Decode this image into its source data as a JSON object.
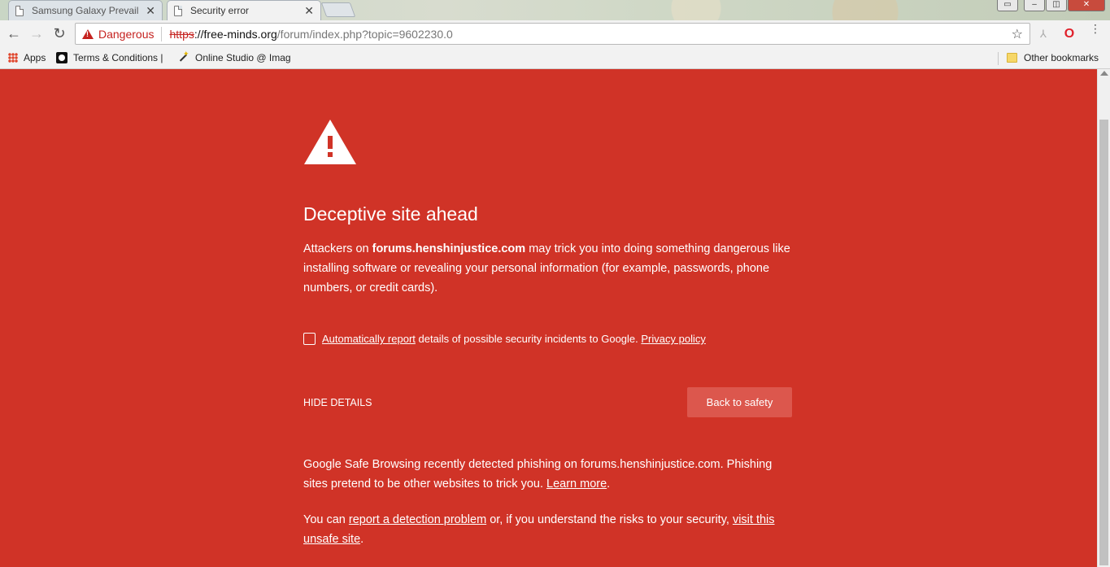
{
  "browser": {
    "tabs": [
      {
        "title": "Samsung Galaxy Prevail T",
        "close": "✕"
      },
      {
        "title": "Security error",
        "close": "✕"
      }
    ],
    "window_controls": [
      "▭",
      "–",
      "◫",
      "✕"
    ],
    "nav": {
      "back": "←",
      "forward": "→",
      "reload": "↻"
    },
    "omnibox": {
      "security_label": "Dangerous",
      "scheme": "https",
      "host": "://free-minds.org",
      "path": "/forum/index.php?topic=9602230.0",
      "star": "☆"
    },
    "extensions": {
      "pdf": "⅄",
      "opera": "O",
      "menu": "⋮"
    },
    "bookmarks": {
      "apps": "Apps",
      "terms": "Terms & Conditions |",
      "studio": "Online Studio @ Imag",
      "other": "Other bookmarks"
    }
  },
  "interstitial": {
    "icon": "warning-triangle-icon",
    "heading": "Deceptive site ahead",
    "intro_before": "Attackers on ",
    "site": "forums.henshinjustice.com",
    "intro_after": " may trick you into doing something dangerous like installing software or revealing your personal information (for example, passwords, phone numbers, or credit cards).",
    "optin_link": "Automatically report",
    "optin_text": " details of possible security incidents to Google. ",
    "privacy_link": "Privacy policy",
    "hide_details": "Hide details",
    "back_to_safety": "Back to safety",
    "details_1_text": "Google Safe Browsing recently detected phishing on forums.henshinjustice.com. Phishing sites pretend to be other websites to trick you. ",
    "learn_more": "Learn more",
    "period": ".",
    "details_2_before": "You can ",
    "report_link": "report a detection problem",
    "details_2_middle": " or, if you understand the risks to your security, ",
    "visit_link": "visit this unsafe site",
    "details_2_end": "."
  },
  "colors": {
    "background": "#d03327",
    "button": "#dc574d",
    "danger": "#c5221f"
  }
}
